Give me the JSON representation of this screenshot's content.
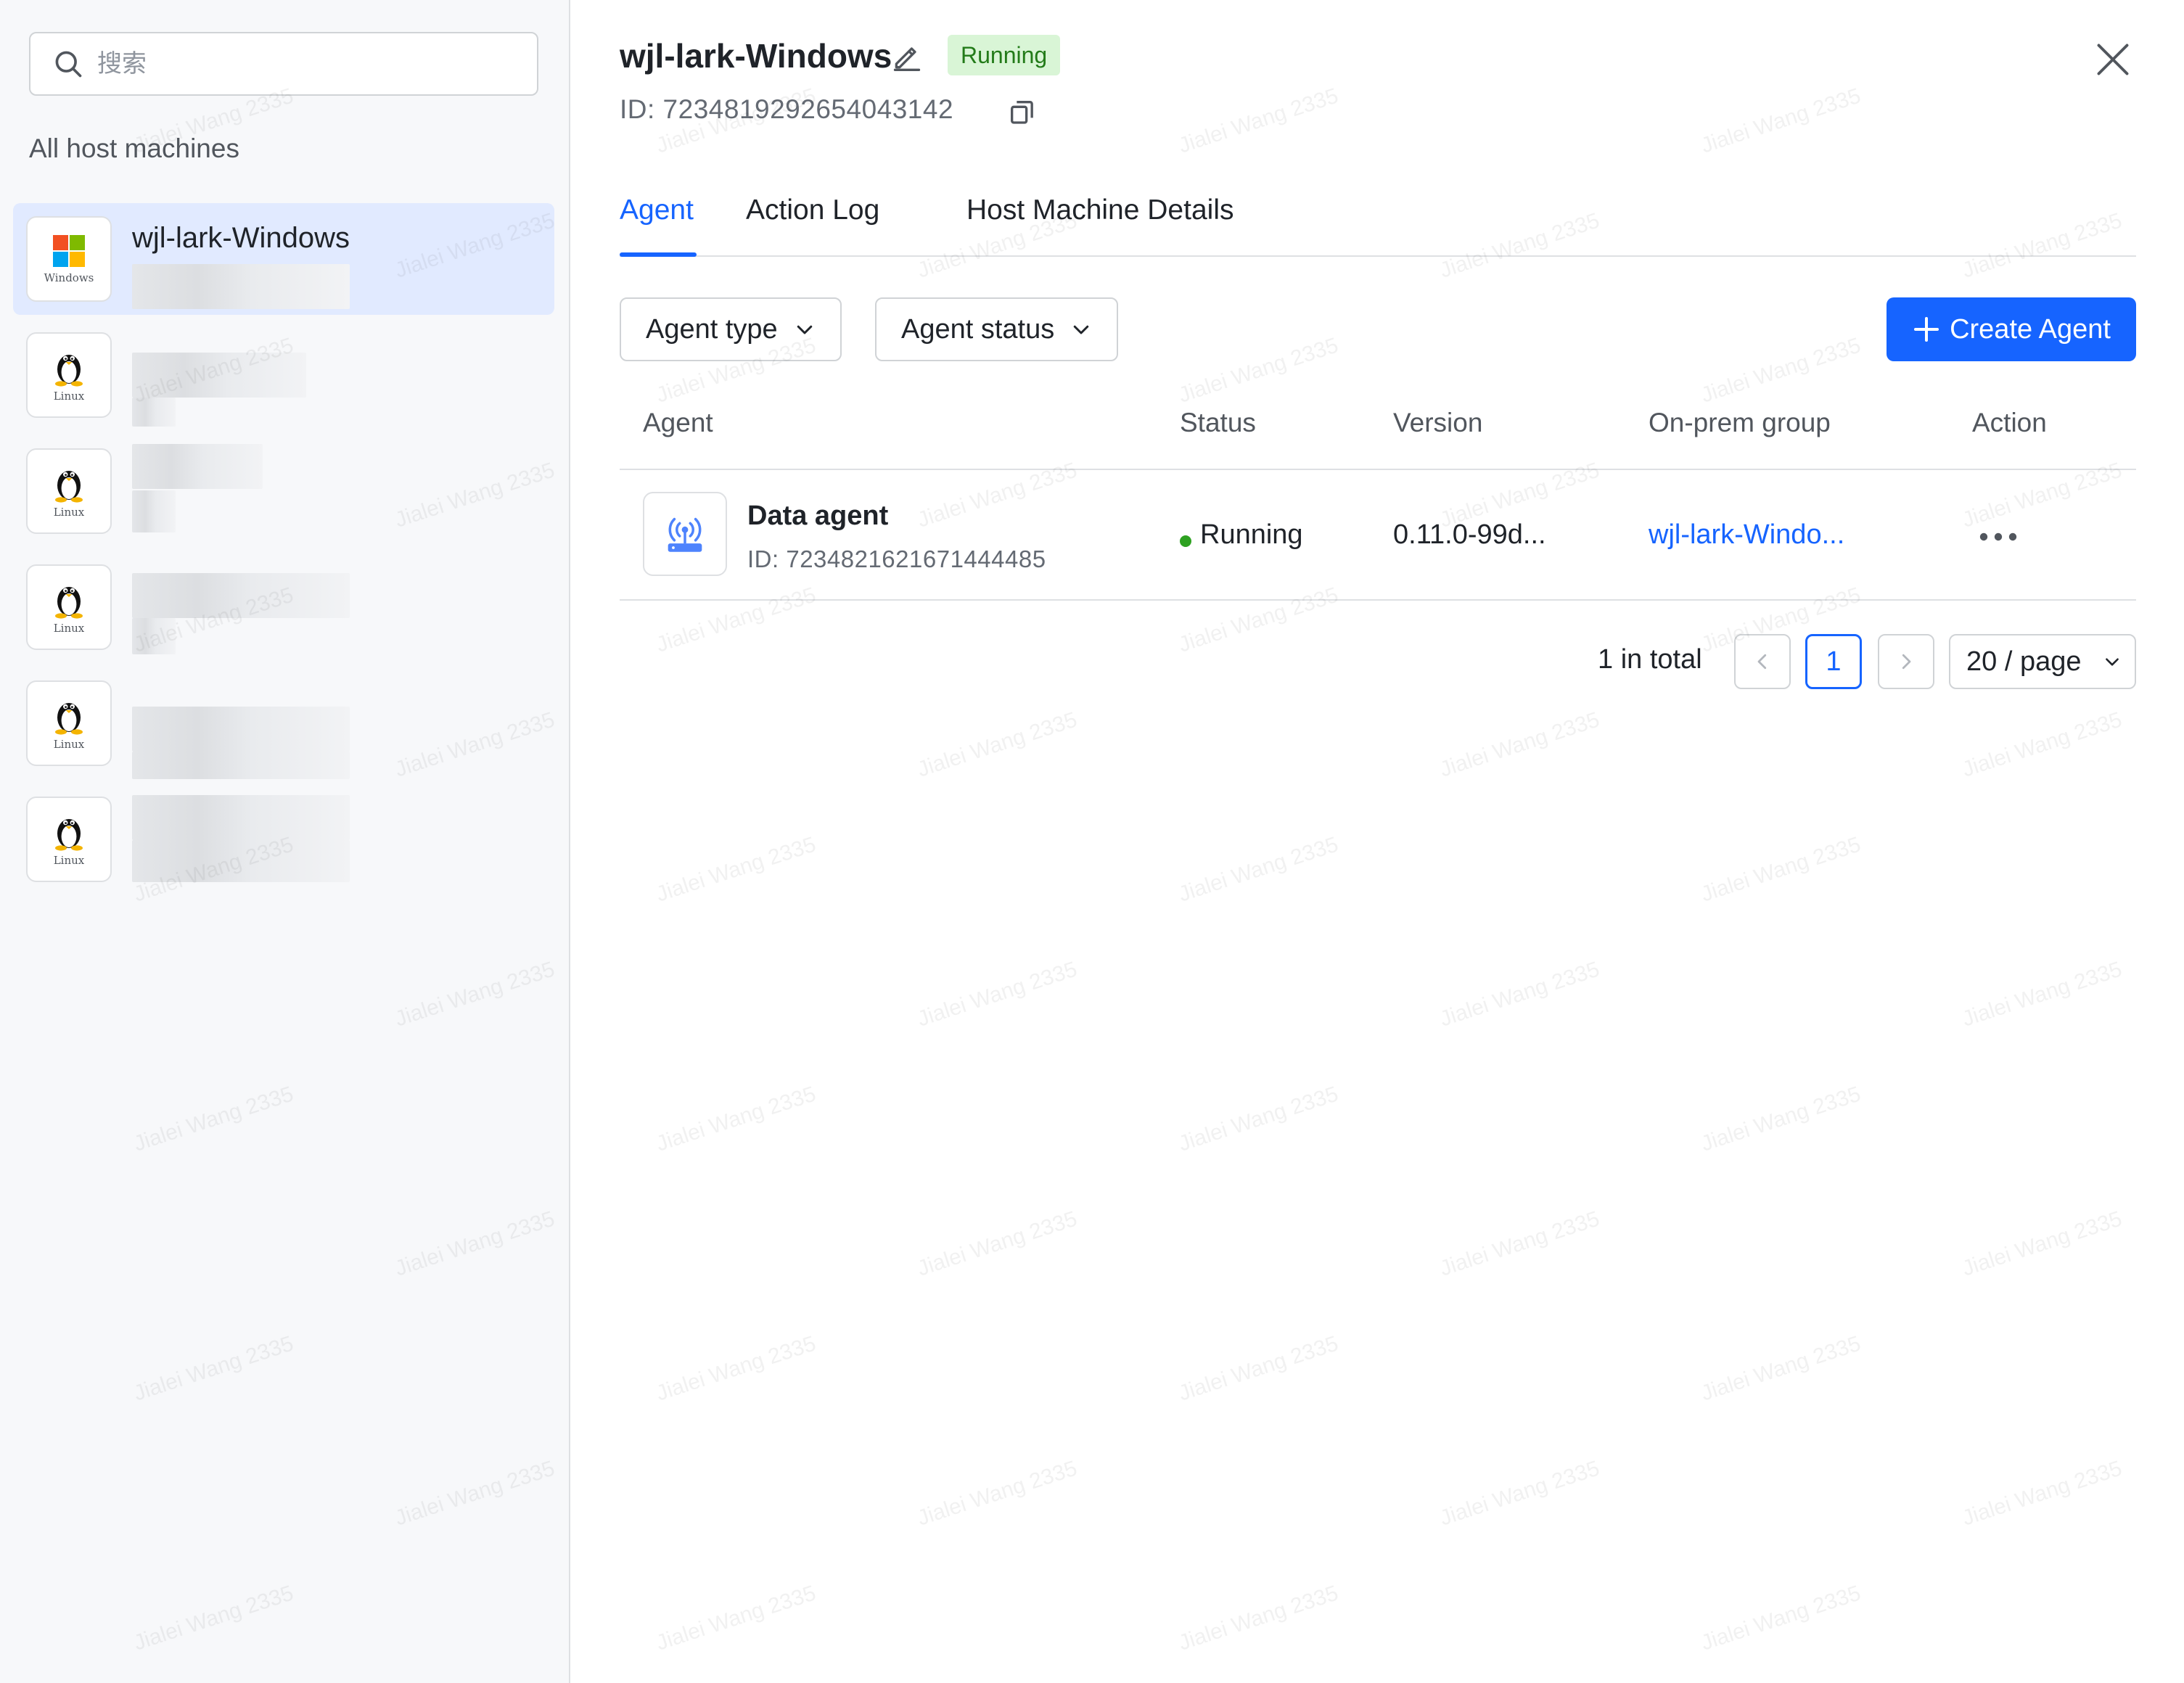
{
  "sidebar": {
    "search_placeholder": "搜索",
    "section_title": "All host machines",
    "hosts": [
      {
        "name": "wjl-lark-Windows",
        "os": "Windows",
        "os_icon": "windows-logo-icon",
        "selected": true
      },
      {
        "name": "",
        "os": "Linux",
        "os_icon": "linux-tux-icon",
        "selected": false
      },
      {
        "name": "",
        "os": "Linux",
        "os_icon": "linux-tux-icon",
        "selected": false
      },
      {
        "name": "",
        "os": "Linux",
        "os_icon": "linux-tux-icon",
        "selected": false
      },
      {
        "name": "",
        "os": "Linux",
        "os_icon": "linux-tux-icon",
        "selected": false
      },
      {
        "name": "",
        "os": "Linux",
        "os_icon": "linux-tux-icon",
        "selected": false
      }
    ]
  },
  "header": {
    "title": "wjl-lark-Windows",
    "status": "Running",
    "id": "ID: 7234819292654043142",
    "icons": [
      "edit-icon",
      "copy-icon",
      "close-icon"
    ]
  },
  "tabs": [
    {
      "label": "Agent",
      "active": true
    },
    {
      "label": "Action Log",
      "active": false
    },
    {
      "label": "Host Machine Details",
      "active": false
    }
  ],
  "toolbar": {
    "agent_type_label": "Agent type",
    "agent_status_label": "Agent status",
    "create_label": "Create Agent"
  },
  "table": {
    "columns": [
      "Agent",
      "Status",
      "Version",
      "On-prem group",
      "Action"
    ],
    "rows": [
      {
        "name": "Data agent",
        "id": "ID: 7234821621671444485",
        "status": "Running",
        "version": "0.11.0-99d...",
        "group": "wjl-lark-Windo...",
        "icon": "router-antenna-icon"
      }
    ]
  },
  "pagination": {
    "total": "1 in total",
    "current_page": "1",
    "page_size": "20 / page"
  },
  "watermark": "Jialei Wang 2335",
  "colors": {
    "accent": "#1664ff",
    "running_bg": "#d9f5d6",
    "running_text": "#237b19",
    "status_dot": "#2ea121",
    "selected_bg": "#e1eaff"
  }
}
